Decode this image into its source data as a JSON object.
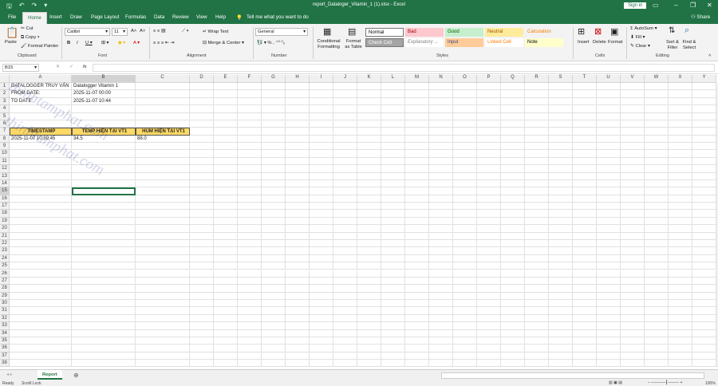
{
  "title": "report_Dataloger_Vitamin_1 (1).xlsx  -  Excel",
  "signin": "Sign in",
  "share": "Share",
  "tabs": [
    "File",
    "Home",
    "Insert",
    "Draw",
    "Page Layout",
    "Formulas",
    "Data",
    "Review",
    "View",
    "Help"
  ],
  "tell_me": "Tell me what you want to do",
  "clipboard": {
    "paste": "Paste",
    "cut": "Cut",
    "copy": "Copy",
    "format_painter": "Format Painter",
    "label": "Clipboard"
  },
  "font": {
    "name": "Calibri",
    "size": "11",
    "label": "Font"
  },
  "alignment": {
    "wrap": "Wrap Text",
    "merge": "Merge & Center",
    "label": "Alignment"
  },
  "number": {
    "format": "General",
    "label": "Number"
  },
  "styles": {
    "conditional": "Conditional Formatting",
    "format_table": "Format as Table",
    "label": "Styles",
    "items": [
      {
        "t": "Normal",
        "bg": "#ffffff",
        "fg": "#000000"
      },
      {
        "t": "Bad",
        "bg": "#ffc7ce",
        "fg": "#9c0006"
      },
      {
        "t": "Good",
        "bg": "#c6efce",
        "fg": "#006100"
      },
      {
        "t": "Neutral",
        "bg": "#ffeb9c",
        "fg": "#9c5700"
      },
      {
        "t": "Calculation",
        "bg": "#f2f2f2",
        "fg": "#fa7d00"
      },
      {
        "t": "Check Cell",
        "bg": "#a5a5a5",
        "fg": "#ffffff"
      },
      {
        "t": "Explanatory ...",
        "bg": "#ffffff",
        "fg": "#7f7f7f"
      },
      {
        "t": "Input",
        "bg": "#ffcc99",
        "fg": "#3f3f76"
      },
      {
        "t": "Linked Cell",
        "bg": "#ffffff",
        "fg": "#fa7d00"
      },
      {
        "t": "Note",
        "bg": "#ffffcc",
        "fg": "#000000"
      }
    ]
  },
  "cells_group": {
    "insert": "Insert",
    "delete": "Delete",
    "format": "Format",
    "label": "Cells"
  },
  "editing": {
    "autosum": "AutoSum",
    "fill": "Fill",
    "clear": "Clear",
    "sort": "Sort & Filter",
    "find": "Find & Select",
    "label": "Editing"
  },
  "namebox": "B15",
  "fx": "fx",
  "columns": [
    "A",
    "B",
    "C",
    "D",
    "E",
    "F",
    "G",
    "H",
    "I",
    "J",
    "K",
    "L",
    "M",
    "N",
    "O",
    "P",
    "Q",
    "R",
    "S",
    "T",
    "U",
    "V",
    "W",
    "X",
    "Y"
  ],
  "rows": [
    "1",
    "2",
    "3",
    "4",
    "5",
    "6",
    "7",
    "8",
    "9",
    "10",
    "11",
    "12",
    "13",
    "14",
    "15",
    "16",
    "17",
    "18",
    "19",
    "20",
    "21",
    "22",
    "23",
    "24",
    "25",
    "26",
    "27",
    "28",
    "29",
    "30",
    "31",
    "32",
    "33",
    "34",
    "35",
    "36",
    "37",
    "38"
  ],
  "cells": {
    "r1": [
      "DATALOGGER TRUY VẤN",
      "Datalogger Vitamin 1"
    ],
    "r2": [
      "FROM DATE:",
      "2025-11-07 00:00"
    ],
    "r3": [
      "TO DATE:",
      "2025-11-07 10:44"
    ],
    "header": [
      "TIMESTAMP",
      "TEMP HIỆN TẠI VT1",
      "HUM HIỆN TẠI VT1"
    ],
    "r8": [
      "2025-11-07 10:39:45",
      "34.5",
      "88.0"
    ]
  },
  "header_fill": "#ffd966",
  "selected_cell": "B15",
  "watermark": "thinhtamphat.com",
  "sheet_tab": "Report",
  "status": {
    "ready": "Ready",
    "scroll_lock": "Scroll Lock",
    "zoom": "100%"
  },
  "accent": "#217346"
}
